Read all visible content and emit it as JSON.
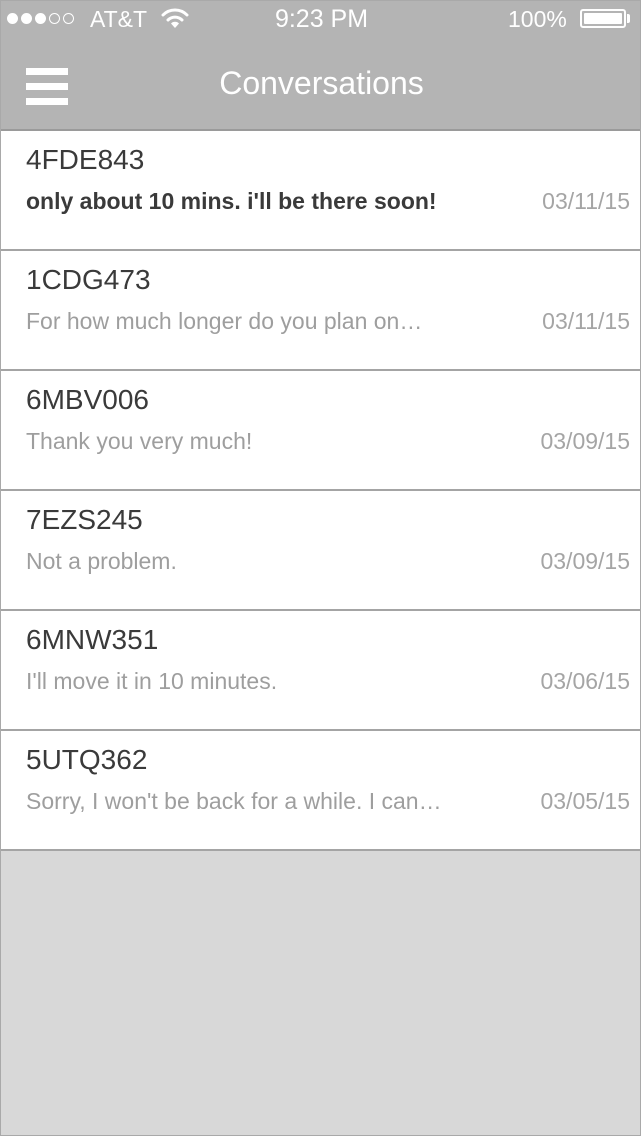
{
  "status_bar": {
    "signal_bars": [
      true,
      true,
      true,
      false,
      false
    ],
    "carrier": "AT&T",
    "time": "9:23 PM",
    "battery_percent": "100%",
    "battery_level": 1.0
  },
  "header": {
    "title": "Conversations",
    "menu_icon": "hamburger-menu-icon"
  },
  "conversations": [
    {
      "id": "4FDE843",
      "preview": "only about 10 mins. i'll be there soon!",
      "date": "03/11/15",
      "unread": true
    },
    {
      "id": "1CDG473",
      "preview": "For how much longer do you plan on…",
      "date": "03/11/15",
      "unread": false
    },
    {
      "id": "6MBV006",
      "preview": "Thank you very much!",
      "date": "03/09/15",
      "unread": false
    },
    {
      "id": "7EZS245",
      "preview": "Not a problem.",
      "date": "03/09/15",
      "unread": false
    },
    {
      "id": "6MNW351",
      "preview": "I'll move it in 10 minutes.",
      "date": "03/06/15",
      "unread": false
    },
    {
      "id": "5UTQ362",
      "preview": "Sorry, I won't be back for a while. I can…",
      "date": "03/05/15",
      "unread": false
    }
  ],
  "colors": {
    "header_background": "#b4b4b4",
    "list_background": "#ffffff",
    "empty_background": "#d8d8d8"
  }
}
